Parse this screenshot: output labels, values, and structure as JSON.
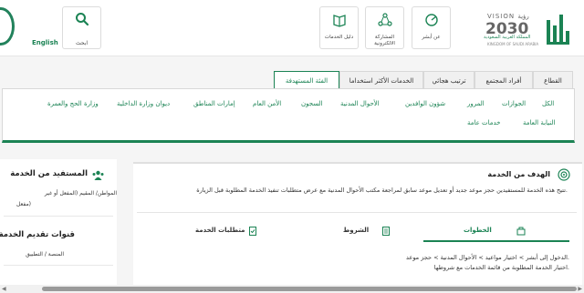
{
  "header": {
    "language_link": "English",
    "search_label": "ابحث",
    "tiles": [
      {
        "label": "دليل الخدمات",
        "icon": "book-icon"
      },
      {
        "label": "المشاركة الالكترونية",
        "icon": "participation-icon"
      },
      {
        "label": "عن أبشر",
        "icon": "about-icon"
      }
    ],
    "vision": {
      "line1": "VISION رؤية",
      "line2": "2030",
      "line3": "المملكة العربية السعودية",
      "line4": "KINGDOM OF SAUDI ARABIA"
    },
    "brand_color": "#1b8354"
  },
  "category_tabs": [
    {
      "label": "القطاع",
      "active": false
    },
    {
      "label": "أفراد المجتمع",
      "active": false
    },
    {
      "label": "ترتيب هجائي",
      "active": false
    },
    {
      "label": "الخدمات الأكثر استخداما",
      "active": false
    },
    {
      "label": "الفئة المستهدفة",
      "active": true
    }
  ],
  "category_links": [
    "الكل",
    "الجوازات",
    "المرور",
    "شؤون الوافدين",
    "الأحوال المدنية",
    "السجون",
    "الأمن العام",
    "إمارات المناطق",
    "ديوان وزارة الداخلية",
    "وزارة الحج والعمرة",
    "النيابة العامة",
    "خدمات عامة"
  ],
  "sidebar": {
    "beneficiary_title": "المستفيد من الخدمة",
    "beneficiary_text_1": "المواطن/ المقيم (المفعل أو غير",
    "beneficiary_text_2": "مفعل)",
    "channels_title": "قنوات تقديم الخدمة",
    "channels_text": "المنصة / التطبيق"
  },
  "main": {
    "goal_title": "الهدف من الخدمة",
    "goal_description": "تتيح هذه الخدمة للمستفيدين حجز موعد جديد أو تعديل موعد سابق لمراجعة مكتب الأحوال المدنية مع عرض متطلبات تنفيذ الخدمة المطلوبة قبل الزيارة.",
    "tabs": [
      {
        "label": "الخطوات",
        "active": true
      },
      {
        "label": "الشروط",
        "active": false
      },
      {
        "label": "متطلبات الخدمة",
        "active": false
      }
    ],
    "steps": [
      "الدخول إلى أبشر > اختيار مواعيد > الأحوال المدنية > حجز موعد.",
      "اختيار الخدمة المطلوبة من قائمة الخدمات مع شروطها."
    ]
  }
}
